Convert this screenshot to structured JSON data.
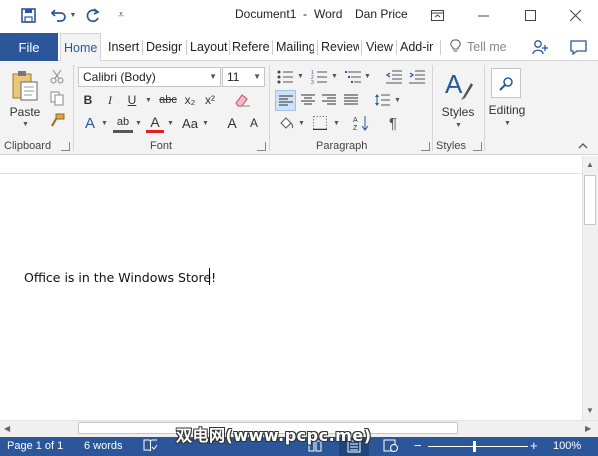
{
  "titlebar": {
    "document_name": "Document1",
    "separator": "-",
    "app_name": "Word",
    "user_name": "Dan Price",
    "save_icon": "save-icon",
    "undo_icon": "undo-icon",
    "redo_icon": "redo-icon",
    "customize_icon": "customize-qat-icon",
    "accent": "#2b579a"
  },
  "tabs": {
    "file": "File",
    "items": [
      "Home",
      "Insert",
      "Desigr",
      "Layout",
      "Referer",
      "Mailing",
      "Review",
      "View",
      "Add-ir"
    ],
    "tell_me": "Tell me"
  },
  "ribbon": {
    "clipboard": {
      "label": "Clipboard",
      "paste": "Paste"
    },
    "font": {
      "label": "Font",
      "font_name": "Calibri (Body)",
      "font_size": "11",
      "bold": "B",
      "italic": "I",
      "underline": "U",
      "strike": "abc",
      "subscript": "x₂",
      "superscript": "x²",
      "effects": "A",
      "highlight": "ab",
      "font_color": "A",
      "change_case": "Aa",
      "grow": "A",
      "shrink": "A"
    },
    "paragraph": {
      "label": "Paragraph",
      "pilcrow": "¶"
    },
    "styles": {
      "label": "Styles",
      "button": "Styles"
    },
    "editing": {
      "button": "Editing"
    }
  },
  "document": {
    "text": "Office is in the Windows Store!"
  },
  "status": {
    "page": "Page 1 of 1",
    "words": "6 words",
    "zoom_minus": "−",
    "zoom_plus": "+",
    "zoom": "100%"
  },
  "watermark": "双电网(www.pcpc.me)"
}
